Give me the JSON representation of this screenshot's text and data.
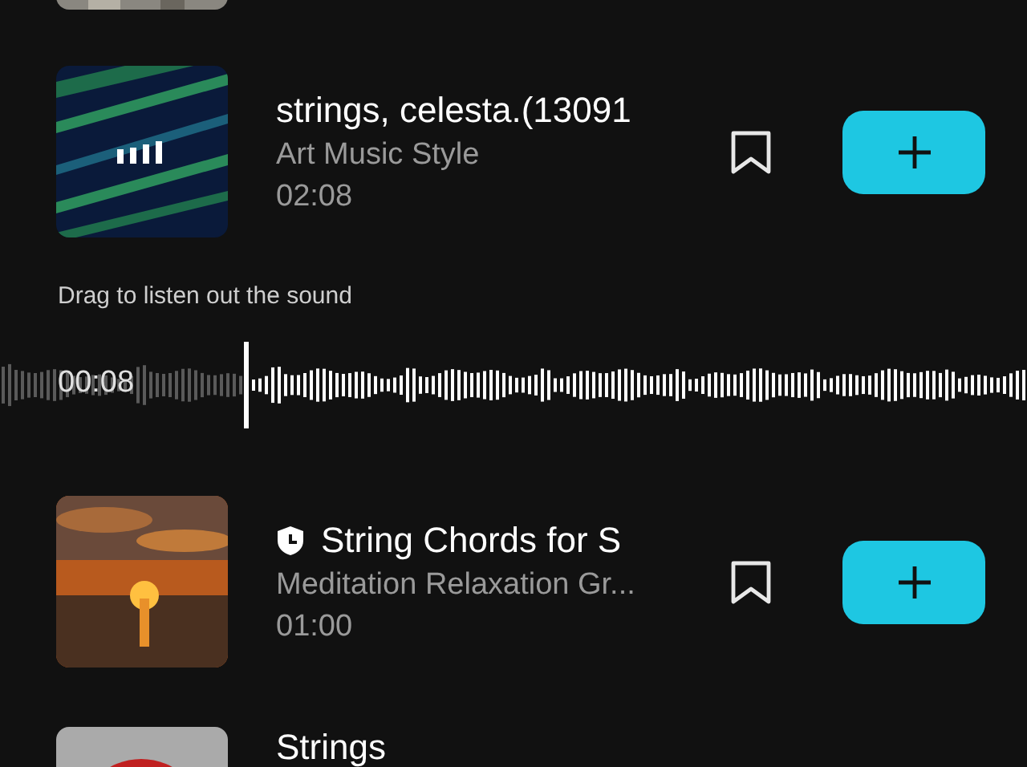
{
  "list": [
    {
      "kind": "picture"
    },
    {
      "kind": "track",
      "title": "strings, celesta.(13091",
      "artist": "Art Music Style",
      "duration": "02:08",
      "playing": true,
      "badge": false,
      "saved": false
    },
    {
      "kind": "preview",
      "hint": "Drag to listen out the sound",
      "time": "00:08"
    },
    {
      "kind": "track",
      "title": "String Chords for S",
      "artist": "Meditation Relaxation Gr...",
      "duration": "01:00",
      "playing": false,
      "badge": true,
      "saved": false
    },
    {
      "kind": "cut",
      "title": "Strings"
    }
  ]
}
